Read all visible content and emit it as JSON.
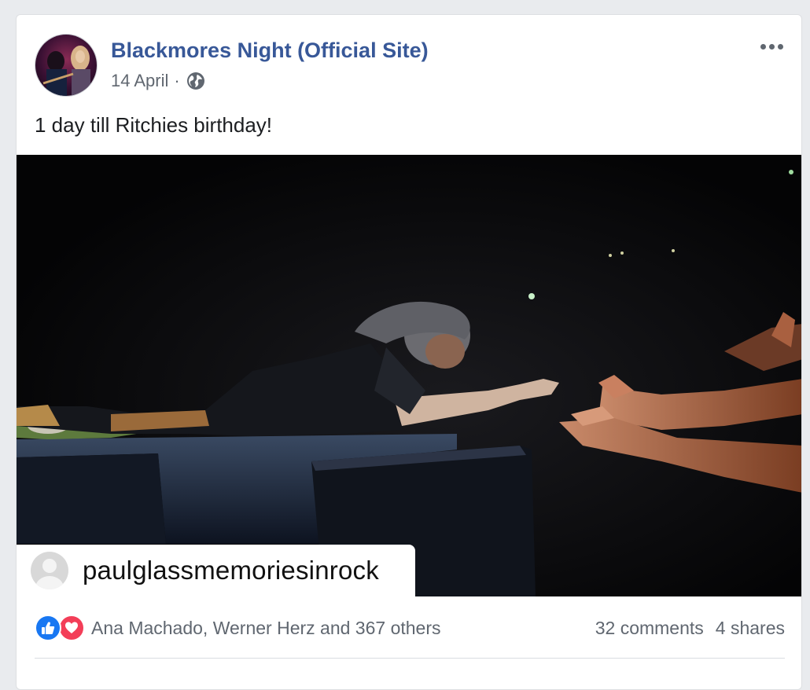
{
  "post": {
    "page_name": "Blackmores Night (Official Site)",
    "date": "14 April",
    "separator": "·",
    "privacy_icon": "globe-icon",
    "more_icon": "more-options-icon",
    "text": "1 day till Ritchies birthday!"
  },
  "photo": {
    "watermark_username": "paulglassmemoriesinrock",
    "watermark_avatar_icon": "default-avatar-icon"
  },
  "engagement": {
    "reaction_icons": [
      "like-icon",
      "love-icon"
    ],
    "reactors_text": "Ana Machado, Werner Herz and 367 others",
    "comments": "32 comments",
    "shares": "4 shares"
  },
  "colors": {
    "page_name": "#385898",
    "secondary_text": "#606770",
    "like": "#1877f2",
    "love": "#f33e58",
    "background": "#e9ebee"
  }
}
